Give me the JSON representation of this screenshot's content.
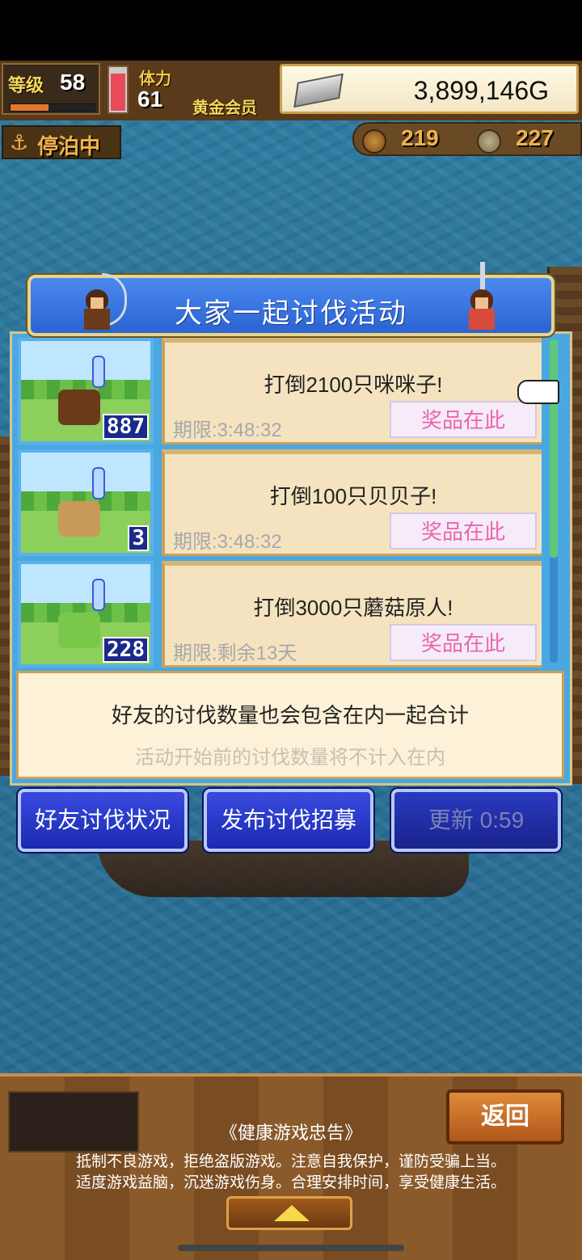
{
  "hud": {
    "level_label": "等级",
    "level_value": "58",
    "level_progress": 0.45,
    "stamina_label": "体力",
    "stamina_value": "61",
    "stamina_fill": 0.9,
    "membership": "黄金会员",
    "money": "3,899,146G",
    "anchor_status": "停泊中",
    "resource_wood": "219",
    "resource_ore": "227"
  },
  "panel": {
    "title": "大家一起讨伐活动"
  },
  "events": [
    {
      "name": "打倒2100只咪咪子!",
      "deadline": "期限:3:48:32",
      "reward_label": "奖品在此",
      "count": "887",
      "monster_color": "#6a3a1a"
    },
    {
      "name": "打倒100只贝贝子!",
      "deadline": "期限:3:48:32",
      "reward_label": "奖品在此",
      "count": "3",
      "monster_color": "#c89a5a"
    },
    {
      "name": "打倒3000只蘑菇原人!",
      "deadline": "期限:剩余13天",
      "reward_label": "奖品在此",
      "count": "228",
      "monster_color": "#7ac84a"
    }
  ],
  "info": {
    "main": "好友的讨伐数量也会包含在内一起合计",
    "sub": "活动开始前的讨伐数量将不计入在内"
  },
  "actions": {
    "friends": "好友讨伐状况",
    "recruit": "发布讨伐招募",
    "refresh": "更新 0:59"
  },
  "bottom": {
    "back": "返回",
    "advisory_title": "《健康游戏忠告》",
    "advisory_line1": "抵制不良游戏，拒绝盗版游戏。注意自我保护，谨防受骗上当。",
    "advisory_line2": "适度游戏益脑，沉迷游戏伤身。合理安排时间，享受健康生活。"
  }
}
